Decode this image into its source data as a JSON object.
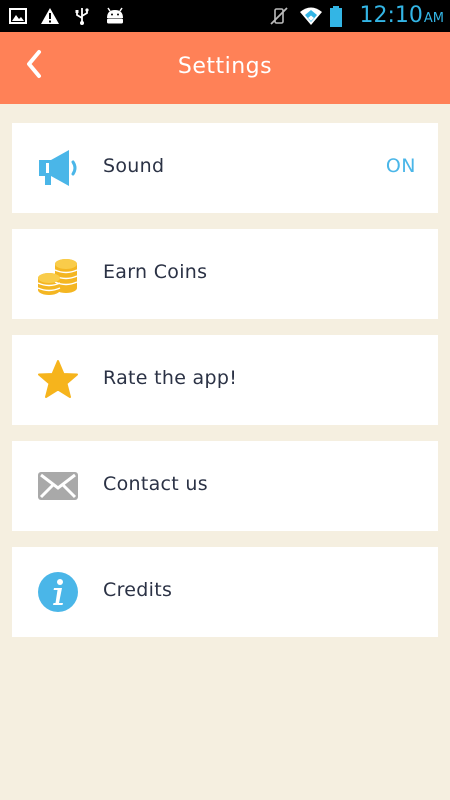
{
  "status_bar": {
    "time": "12:10",
    "ampm": "AM",
    "left_icons": [
      "image-icon",
      "warning-icon",
      "usb-icon",
      "android-icon"
    ],
    "right_icons": [
      "vibrate-off-icon",
      "wifi-icon",
      "battery-icon"
    ]
  },
  "header": {
    "title": "Settings",
    "back_icon": "chevron-left-icon",
    "background": "#ff8157"
  },
  "settings": [
    {
      "label": "Sound",
      "value": "ON",
      "icon": "megaphone-icon"
    },
    {
      "label": "Earn Coins",
      "icon": "coins-icon"
    },
    {
      "label": "Rate the app!",
      "icon": "star-icon"
    },
    {
      "label": "Contact us",
      "icon": "envelope-icon"
    },
    {
      "label": "Credits",
      "icon": "info-icon"
    }
  ],
  "colors": {
    "background": "#f5efe0",
    "accent_blue": "#4ab6e8",
    "coin_gold": "#f4b622",
    "star_gold": "#f6b41c",
    "envelope_gray": "#a9a9a9"
  }
}
